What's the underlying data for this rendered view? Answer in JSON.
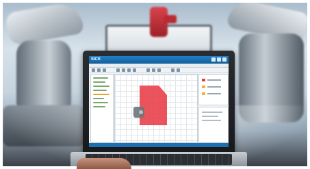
{
  "photo": {
    "subject": "laptop-showing-safety-configuration-software",
    "background": "industrial-robots-workshop"
  },
  "software": {
    "brand": "SICK",
    "field_color": "#e8363f",
    "sensor_color": "#6f7378",
    "accent_color": "#1f7fc7"
  }
}
